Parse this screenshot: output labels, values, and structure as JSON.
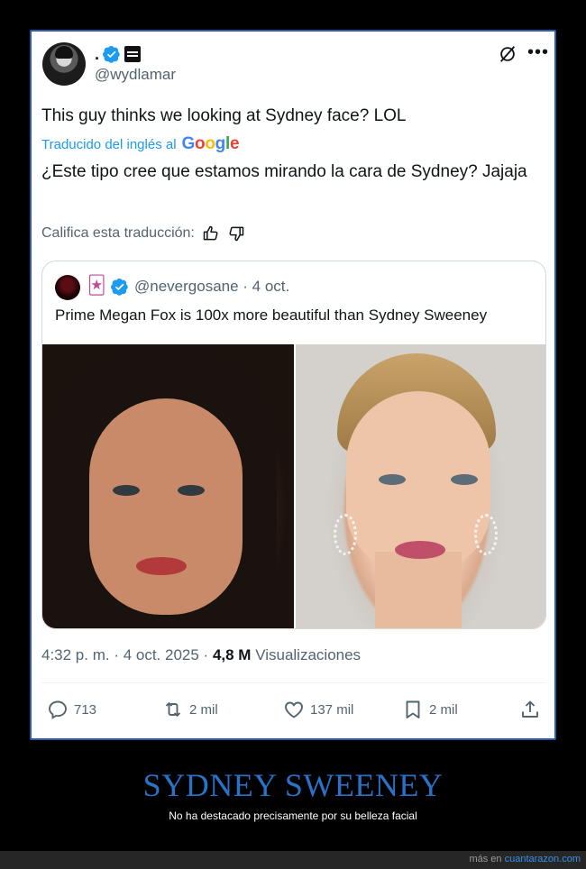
{
  "tweet": {
    "display_name": ".",
    "handle": "@wydlamar",
    "text": "This guy thinks we looking at Sydney face? LOL",
    "translated_label": "Traducido del inglés al",
    "google_letters": [
      "G",
      "o",
      "o",
      "g",
      "l",
      "e"
    ],
    "translation": "¿Este tipo cree que estamos mirando la cara de Sydney? Jajaja",
    "rate_label": "Califica esta traducción:",
    "timestamp": "4:32 p. m. · 4 oct. 2025 · ",
    "views_value": "4,8 M",
    "views_label": " Visualizaciones",
    "actions": {
      "replies": "713",
      "retweets": "2 mil",
      "likes": "137 mil",
      "bookmarks": "2 mil"
    }
  },
  "quoted": {
    "emoji": "🃏",
    "meta": "@nevergosane · 4 oct.",
    "text": "Prime Megan Fox is 100x more beautiful than Sydney Sweeney"
  },
  "caption": {
    "headline": "SYDNEY SWEENEY",
    "subline": "No ha destacado precisamente por su belleza facial"
  },
  "footer": {
    "prefix": "más en ",
    "site": "cuantarazon.com"
  },
  "colors": {
    "accent": "#1d9bf0",
    "verified": "#1d9bf0",
    "border": "#2a5db0",
    "headline": "#2a72c8"
  },
  "icons": [
    "verified-icon",
    "affiliate-badge-icon",
    "grok-icon",
    "more-icon",
    "thumbs-up-icon",
    "thumbs-down-icon",
    "reply-icon",
    "retweet-icon",
    "like-icon",
    "bookmark-icon",
    "share-icon"
  ]
}
